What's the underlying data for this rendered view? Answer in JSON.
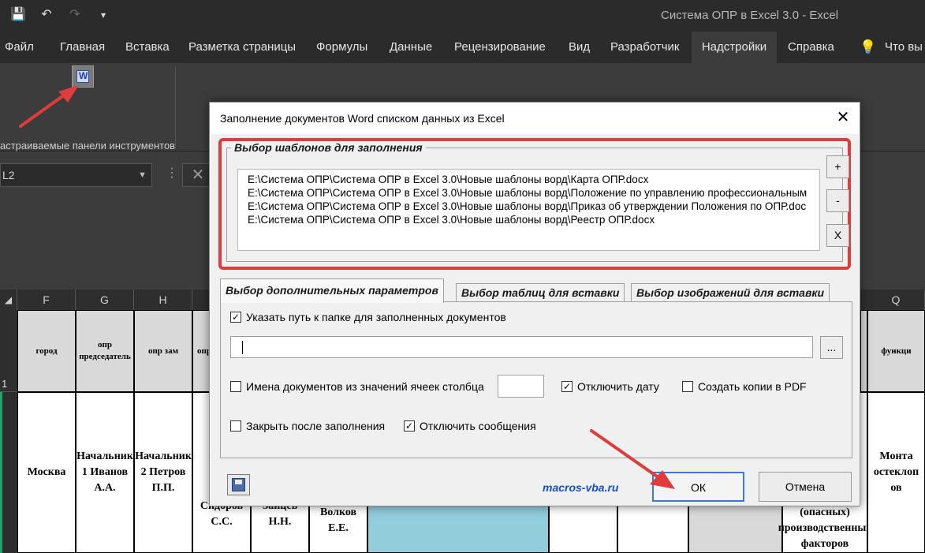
{
  "window": {
    "title": "Система ОПР в Excel 3.0  -  Excel",
    "qat": {
      "save_icon": "save-icon",
      "undo_icon": "undo-icon",
      "redo_icon": "redo-icon",
      "customize_icon": "customize-icon"
    }
  },
  "ribbon": {
    "tabs": [
      "Файл",
      "Главная",
      "Вставка",
      "Разметка страницы",
      "Формулы",
      "Данные",
      "Рецензирование",
      "Вид",
      "Разработчик",
      "Надстройки",
      "Справка"
    ],
    "active_tab": "Надстройки",
    "tell_me": "Что вы",
    "group_label": "астраиваемые панели инструментов",
    "addin_icon": "word-fill-icon"
  },
  "formula_bar": {
    "name_box": "L2",
    "dots": "⋮",
    "cancel": "✕"
  },
  "sheet": {
    "columns": [
      "F",
      "G",
      "H",
      "",
      "",
      "",
      "",
      "",
      "",
      "",
      "",
      "",
      "",
      "",
      "",
      "Q"
    ],
    "row1_label": "1",
    "headers": {
      "f": "город",
      "g": "опр председатель",
      "h": "опр зам",
      "i": "опр",
      "q": "функци"
    },
    "row2": {
      "f": "Москва",
      "g": "Начальник 1 Иванов А.А.",
      "h": "Начальник 2 Петров П.П.",
      "i": "На… Сидоров С.С.",
      "j": "Зайцев Н.Н.",
      "k": "Волков Е.Е.",
      "p": "(опасных) производственных факторов",
      "q": "Монта остеклоп ов"
    }
  },
  "dialog": {
    "title": "Заполнение документов Word списком данных из Excel",
    "close": "✕",
    "templates_legend": "Выбор шаблонов для заполнения",
    "templates": [
      "E:\\Система ОПР\\Система ОПР в Excel 3.0\\Новые шаблоны ворд\\Карта ОПР.docx",
      "E:\\Система ОПР\\Система ОПР в Excel 3.0\\Новые шаблоны ворд\\Положение по управлению профессиональным",
      "E:\\Система ОПР\\Система ОПР в Excel 3.0\\Новые шаблоны ворд\\Приказ об утверждении Положения по ОПР.doc",
      "E:\\Система ОПР\\Система ОПР в Excel 3.0\\Новые шаблоны ворд\\Реестр ОПР.docx"
    ],
    "btn_add": "+",
    "btn_remove": "-",
    "btn_clear": "X",
    "tabs": [
      "Выбор дополнительных параметров",
      "Выбор таблиц для вставки",
      "Выбор изображений для вставки"
    ],
    "active_tab": "Выбор дополнительных параметров",
    "options": {
      "folder_path_label": "Указать путь к папке для заполненных документов",
      "folder_path_checked": true,
      "folder_path_value": "",
      "browse": "...",
      "names_from_column_label": "Имена документов из значений ячеек столбца",
      "names_from_column_checked": false,
      "column_value": "",
      "disable_date_label": "Отключить дату",
      "disable_date_checked": true,
      "pdf_label": "Создать копии в PDF",
      "pdf_checked": false,
      "close_after_label": "Закрыть после заполнения",
      "close_after_checked": false,
      "disable_messages_label": "Отключить сообщения",
      "disable_messages_checked": true
    },
    "link": "macros-vba.ru",
    "ok": "ОК",
    "cancel": "Отмена"
  },
  "colors": {
    "accent_red": "#e03c3c",
    "link_blue": "#1650c8",
    "excel_green": "#21a366",
    "teal_cell": "#92cddc"
  }
}
